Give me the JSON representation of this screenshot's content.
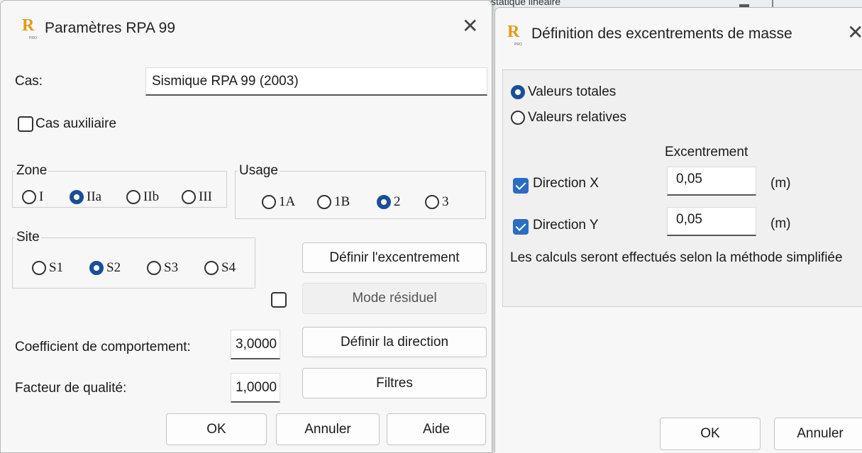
{
  "background": {
    "partial_text": "statique linéaire"
  },
  "rpa": {
    "title": "Paramètres RPA 99",
    "icon": "rsa-app-icon",
    "icon_sub": "PRO",
    "cas_label": "Cas:",
    "cas_value": "Sismique RPA 99 (2003)",
    "cas_auxiliaire": {
      "label": "Cas auxiliaire",
      "checked": false
    },
    "zone": {
      "legend": "Zone",
      "options": [
        "I",
        "IIa",
        "IIb",
        "III"
      ],
      "selected": "IIa"
    },
    "usage": {
      "legend": "Usage",
      "options": [
        "1A",
        "1B",
        "2",
        "3"
      ],
      "selected": "2"
    },
    "site": {
      "legend": "Site",
      "options": [
        "S1",
        "S2",
        "S3",
        "S4"
      ],
      "selected": "S2"
    },
    "definir_excentrement": "Définir l'excentrement",
    "mode_residuel": {
      "label": "Mode résiduel",
      "checked": false
    },
    "coef_label": "Coefficient de comportement:",
    "coef_value": "3,0000",
    "facteur_label": "Facteur de qualité:",
    "facteur_value": "1,0000",
    "definir_direction": "Définir la direction",
    "filtres": "Filtres",
    "ok": "OK",
    "annuler": "Annuler",
    "aide": "Aide"
  },
  "excent": {
    "title": "Définition des excentrements de masse",
    "valeurs_totales": "Valeurs totales",
    "valeurs_relatives": "Valeurs relatives",
    "selected": "Valeurs totales",
    "excentrement_header": "Excentrement",
    "dir_x": {
      "label": "Direction X",
      "checked": true,
      "value": "0,05",
      "unit": "(m)"
    },
    "dir_y": {
      "label": "Direction Y",
      "checked": true,
      "value": "0,05",
      "unit": "(m)"
    },
    "note": "Les calculs seront effectués selon la méthode simplifiée",
    "ok": "OK",
    "annuler": "Annuler"
  },
  "colors": {
    "accent": "#1a4f96",
    "checkbox_on": "#2b6cc4",
    "icon": "#e49a14"
  }
}
